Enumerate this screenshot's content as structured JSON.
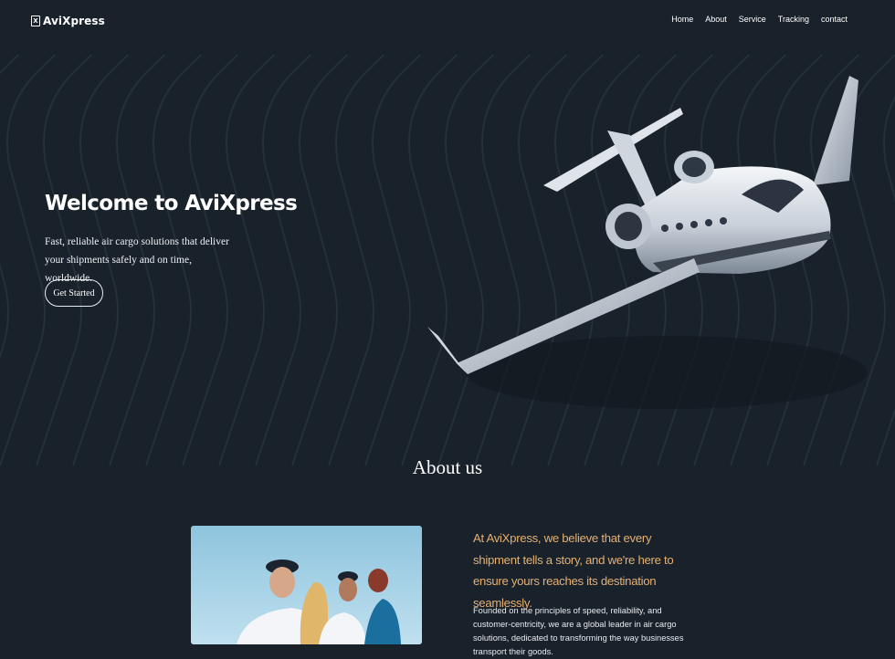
{
  "brand": {
    "name": "AviXpress",
    "mark": "X"
  },
  "nav": {
    "items": [
      "Home",
      "About",
      "Service",
      "Tracking",
      "contact"
    ]
  },
  "hero": {
    "title": "Welcome to AviXpress",
    "subtitle": "Fast, reliable air cargo solutions that deliver your shipments safely and on time, worldwide.",
    "cta": "Get Started"
  },
  "about": {
    "title": "About us",
    "lead": "At AviXpress, we believe that every shipment tells a story, and we're here to ensure yours reaches its destination seamlessly.",
    "body": "Founded on the principles of speed, reliability, and customer-centricity, we are a global leader in air cargo solutions, dedicated to transforming the way businesses transport their goods."
  },
  "colors": {
    "background": "#19212b",
    "accent": "#e5b071",
    "text": "#ffffff"
  }
}
